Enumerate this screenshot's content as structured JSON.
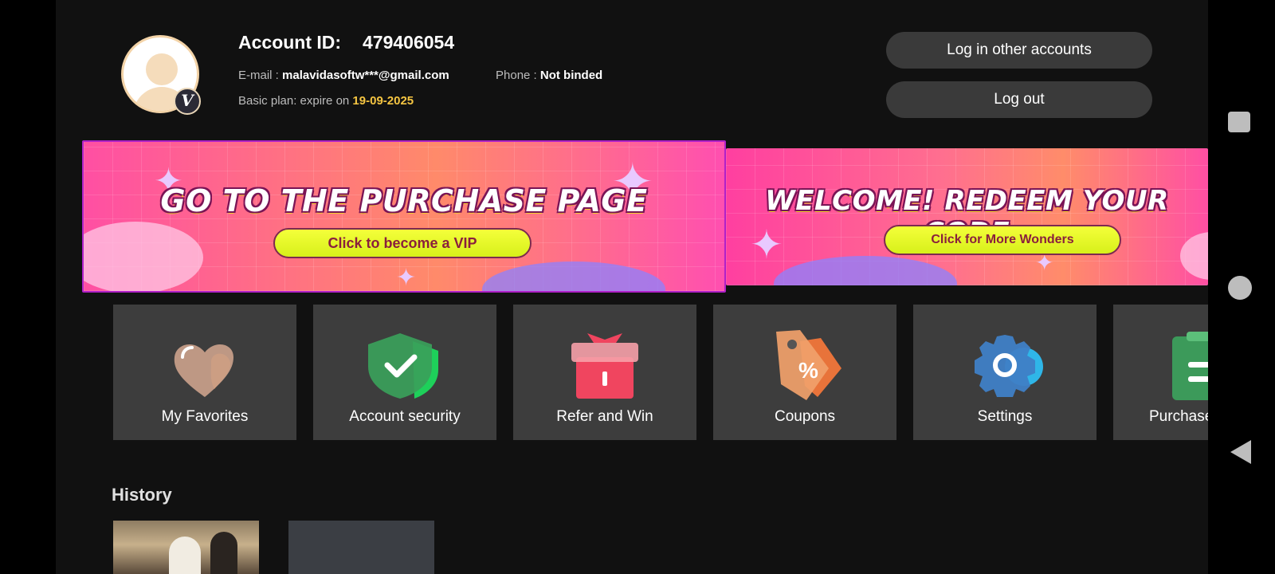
{
  "header": {
    "account_label": "Account ID:",
    "account_id": "479406054",
    "email_label": "E-mail : ",
    "email_value": "malavidasoftw***@gmail.com",
    "phone_label": "Phone : ",
    "phone_value": "Not binded",
    "plan_label": "Basic plan: expire on ",
    "plan_expiry": "19-09-2025",
    "avatar_badge": "V",
    "buttons": {
      "other_accounts": "Log in other accounts",
      "logout": "Log out"
    }
  },
  "banners": [
    {
      "title": "GO TO THE PURCHASE PAGE",
      "cta": "Click to become a VIP"
    },
    {
      "title": "WELCOME!  REDEEM YOUR CODE",
      "cta": "Click for More Wonders"
    }
  ],
  "tiles": [
    {
      "label": "My Favorites",
      "icon": "heart-icon"
    },
    {
      "label": "Account security",
      "icon": "shield-icon"
    },
    {
      "label": "Refer and Win",
      "icon": "gift-icon"
    },
    {
      "label": "Coupons",
      "icon": "coupon-tag-icon"
    },
    {
      "label": "Settings",
      "icon": "gear-icon"
    },
    {
      "label": "Purchase",
      "icon": "clipboard-icon"
    }
  ],
  "history": {
    "title": "History"
  },
  "colors": {
    "background": "#111111",
    "tile": "#3d3d3d",
    "button": "#3a3a3a",
    "accent_gold": "#f5c542",
    "banner_pink": "#ff4fa3",
    "cta_yellow": "#e8f52a"
  }
}
